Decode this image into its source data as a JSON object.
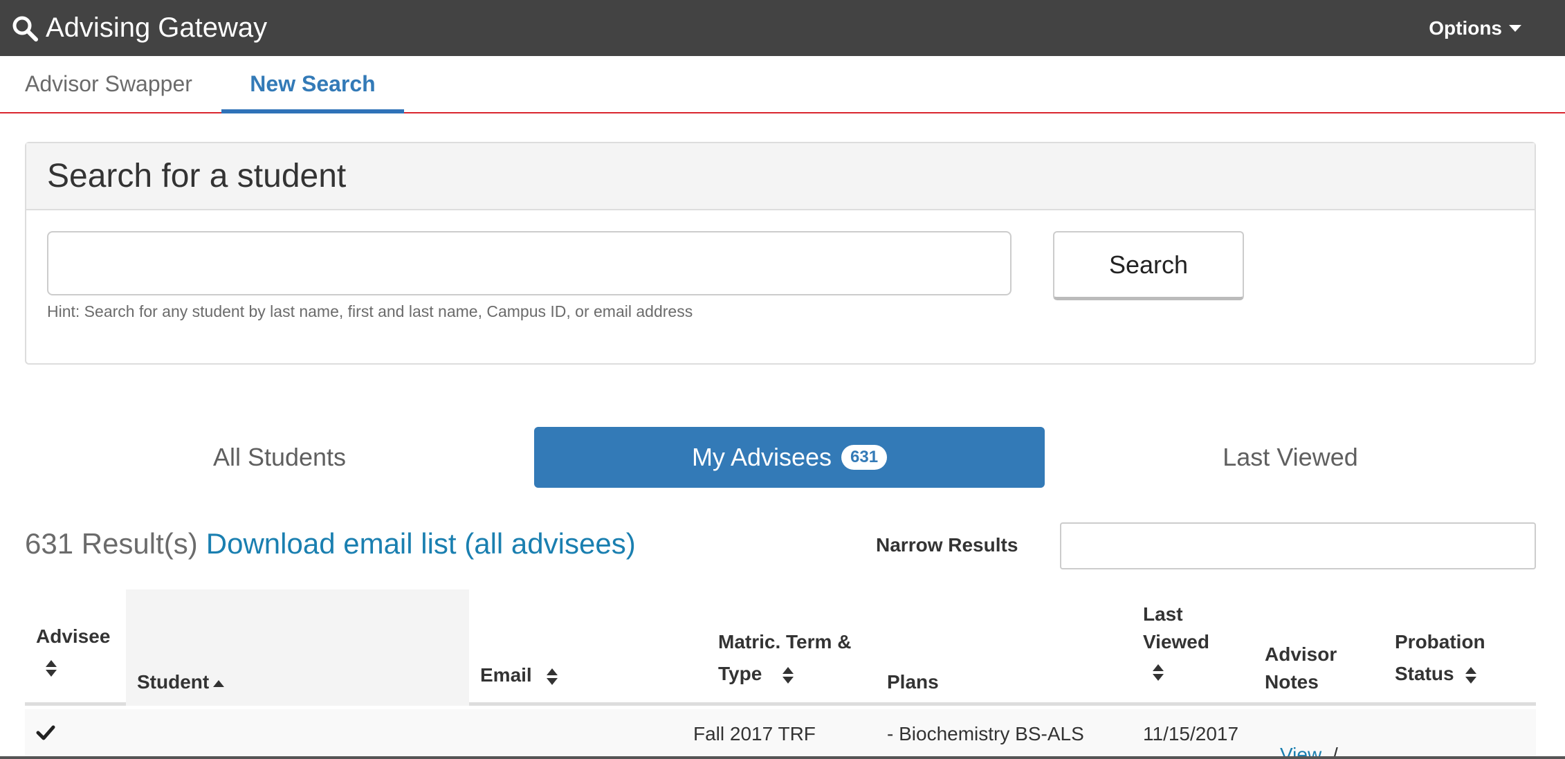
{
  "navbar": {
    "brand": "Advising Gateway",
    "brand_icon": "search-icon",
    "options_label": "Options"
  },
  "tabs": [
    {
      "label": "Advisor Swapper",
      "active": false
    },
    {
      "label": "New Search",
      "active": true
    }
  ],
  "search_panel": {
    "title": "Search for a student",
    "input_value": "",
    "hint": "Hint: Search for any student by last name, first and last name, Campus ID, or email address",
    "button_label": "Search"
  },
  "pills": {
    "all": "All Students",
    "mine": "My Advisees",
    "mine_count": "631",
    "last": "Last Viewed"
  },
  "results": {
    "count_text": "631 Result(s)",
    "download_label": "Download email list (all advisees)",
    "narrow_label": "Narrow Results",
    "narrow_value": ""
  },
  "table": {
    "headers": {
      "advisee": "Advisee",
      "student": "Student",
      "email": "Email",
      "matric_1": "Matric. Term &",
      "matric_2": "Type",
      "plans": "Plans",
      "last_viewed_1": "Last",
      "last_viewed_2": "Viewed",
      "notes_1": "Advisor",
      "notes_2": "Notes",
      "probation_1": "Probation",
      "probation_2": "Status"
    },
    "rows": [
      {
        "advisee_icon": "check-icon",
        "matric": "Fall 2017 TRF",
        "plans": "- Biochemistry BS-ALS",
        "last_viewed": "11/15/2017",
        "notes_link": "View",
        "notes_sep": "/"
      }
    ]
  },
  "colors": {
    "navbar": "#434343",
    "accent": "#337ab7",
    "link": "#1a7fb0",
    "tab_rule": "#d9262f"
  }
}
